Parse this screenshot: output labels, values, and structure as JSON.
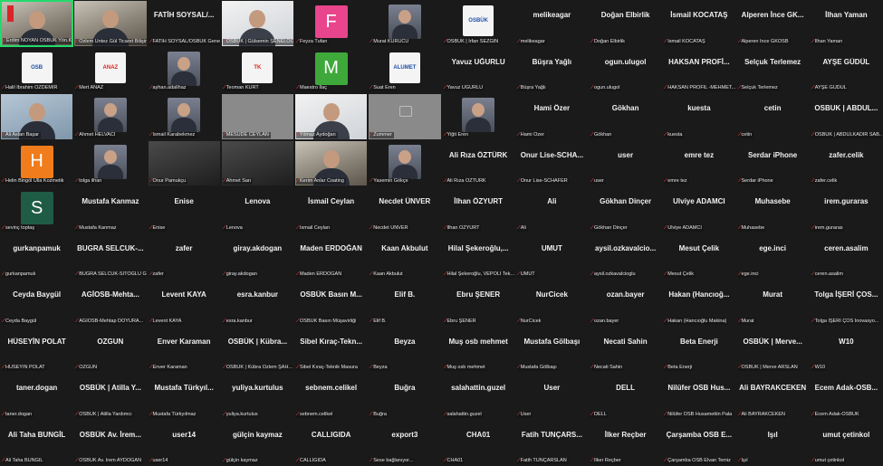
{
  "colors": {
    "background": "#1a1a1a",
    "active_speaker_border": "#23d96a",
    "muted_mic": "#ff3b3b"
  },
  "participants": [
    {
      "kind": "video",
      "variant": "video",
      "flag": true,
      "name": "Erdim NOYAN OSBÜK Yön.Kur.Üyesi",
      "active": true
    },
    {
      "kind": "video",
      "variant": "video",
      "name": "Özlem Üntez Gül Ticaret Bilişim"
    },
    {
      "kind": "name",
      "display": "FATİH SOYSAL/...",
      "name": "FATİH SOYSAL/OSBÜK Genel Sek."
    },
    {
      "kind": "video",
      "variant": "video light",
      "name": "OSBÜK | Gülsemin ŞENELOĞLU"
    },
    {
      "kind": "initial",
      "initial": "F",
      "color": "#e8458d",
      "name": "Feyza Tufan"
    },
    {
      "kind": "photo",
      "name": "Murat KURUCU"
    },
    {
      "kind": "logo",
      "logo": "OSBÜK",
      "name": "OSBÜK | İrfan SEZGİN"
    },
    {
      "kind": "name",
      "display": "melikeagar",
      "name": "melikeagar"
    },
    {
      "kind": "name",
      "display": "Doğan Elbirlik",
      "name": "Doğan Elbirlik"
    },
    {
      "kind": "name",
      "display": "İsmail KOCATAŞ",
      "name": "İsmail KOCATAŞ"
    },
    {
      "kind": "name",
      "display": "Alperen İnce GK...",
      "name": "Alperen İnce GKOSB"
    },
    {
      "kind": "name",
      "display": "İlhan Yaman",
      "name": "İlhan Yaman"
    },
    {
      "kind": "logo",
      "logo": "OSB",
      "name": "Halil İbrahim ÖZDEMİR"
    },
    {
      "kind": "logo",
      "logo": "ANAZ",
      "red": true,
      "name": "Mert ANAZ"
    },
    {
      "kind": "photo",
      "name": "ayhan.adalihaz"
    },
    {
      "kind": "logo",
      "logo": "TK",
      "red": true,
      "name": "Teoman KURT"
    },
    {
      "kind": "initial",
      "initial": "M",
      "color": "#3fa83a",
      "name": "Maestro İlaç"
    },
    {
      "kind": "logo",
      "logo": "ALUMET",
      "name": "Suat Eren"
    },
    {
      "kind": "name",
      "display": "Yavuz UĞURLU",
      "name": "Yavuz UĞURLU"
    },
    {
      "kind": "name",
      "display": "Büşra Yağlı",
      "name": "Büşra Yağlı"
    },
    {
      "kind": "name",
      "display": "ogun.ulugol",
      "name": "ogun.ulugol"
    },
    {
      "kind": "name",
      "display": "HAKSAN PROFİ...",
      "name": "HAKSAN PROFİL -MEHMET..."
    },
    {
      "kind": "name",
      "display": "Selçuk Terlemez",
      "name": "Selçuk Terlemez"
    },
    {
      "kind": "name",
      "display": "AYŞE GÜDÜL",
      "name": "AYŞE GÜDÜL"
    },
    {
      "kind": "video",
      "variant": "video blue",
      "name": "Ali Aslan Başar"
    },
    {
      "kind": "photo",
      "name": "Ahmet HELVACI"
    },
    {
      "kind": "photo",
      "name": "İsmail Karabekmez"
    },
    {
      "kind": "video",
      "variant": "video gray",
      "name": "MESUDE CEYLAN"
    },
    {
      "kind": "video",
      "variant": "video light",
      "name": "Yılmaz Aydoğan"
    },
    {
      "kind": "zoom",
      "variant": "video gray",
      "name": "Zummer"
    },
    {
      "kind": "photo",
      "name": "Yiğit Eren"
    },
    {
      "kind": "name",
      "display": "Hami Özer",
      "name": "Hami Özer"
    },
    {
      "kind": "name",
      "display": "Gökhan",
      "name": "Gökhan"
    },
    {
      "kind": "name",
      "display": "kuesta",
      "name": "kuesta"
    },
    {
      "kind": "name",
      "display": "cetin",
      "name": "cetin"
    },
    {
      "kind": "name",
      "display": "OSBUK | ABDUL...",
      "name": "OSBUK | ABDULKADİR SAB..."
    },
    {
      "kind": "initial",
      "initial": "H",
      "color": "#f07c1b",
      "name": "Helin Bingöl Ulla Kozmetik"
    },
    {
      "kind": "photo",
      "name": "tolga ilhan"
    },
    {
      "kind": "video",
      "variant": "video dark",
      "name": "Onur Pamukçu"
    },
    {
      "kind": "video",
      "variant": "video dark",
      "name": "Ahmet Sarı"
    },
    {
      "kind": "video",
      "variant": "video",
      "name": "Kerim Anlar Coating"
    },
    {
      "kind": "photo",
      "name": "Yasemin Gökçe"
    },
    {
      "kind": "name",
      "display": "Ali Rıza ÖZTÜRK",
      "name": "Ali Rıza ÖZTÜRK"
    },
    {
      "kind": "name",
      "display": "Onur Lise-SCHA...",
      "name": "Onur Lise-SCHAFER"
    },
    {
      "kind": "name",
      "display": "user",
      "name": "user"
    },
    {
      "kind": "name",
      "display": "emre tez",
      "name": "emre tez"
    },
    {
      "kind": "name",
      "display": "Serdar iPhone",
      "name": "Serdar iPhone"
    },
    {
      "kind": "name",
      "display": "zafer.celik",
      "name": "zafer.celik"
    },
    {
      "kind": "initial",
      "initial": "S",
      "color": "#1f5c45",
      "name": "sevinç toptaş"
    },
    {
      "kind": "name",
      "display": "Mustafa Kanmaz",
      "name": "Mustafa Kanmaz"
    },
    {
      "kind": "name",
      "display": "Enise",
      "name": "Enise"
    },
    {
      "kind": "name",
      "display": "Lenova",
      "name": "Lenova"
    },
    {
      "kind": "name",
      "display": "İsmail Ceylan",
      "name": "İsmail Ceylan"
    },
    {
      "kind": "name",
      "display": "Necdet ÜNVER",
      "name": "Necdet ÜNVER"
    },
    {
      "kind": "name",
      "display": "İlhan ÖZYURT",
      "name": "İlhan ÖZYURT"
    },
    {
      "kind": "name",
      "display": "Ali",
      "name": "Ali"
    },
    {
      "kind": "name",
      "display": "Gökhan Dinçer",
      "name": "Gökhan Dinçer"
    },
    {
      "kind": "name",
      "display": "Ulviye ADAMCI",
      "name": "Ulviye ADAMCI"
    },
    {
      "kind": "name",
      "display": "Muhasebe",
      "name": "Muhasebe"
    },
    {
      "kind": "name",
      "display": "irem.guraras",
      "name": "irem.guraras"
    },
    {
      "kind": "name",
      "display": "gurkanpamuk",
      "name": "gurkanpamuk"
    },
    {
      "kind": "name",
      "display": "BUGRA SELCUK-...",
      "name": "BUGRA SELCUK-SITOGLU G..."
    },
    {
      "kind": "name",
      "display": "zafer",
      "name": "zafer"
    },
    {
      "kind": "name",
      "display": "giray.akdogan",
      "name": "giray.akdogan"
    },
    {
      "kind": "name",
      "display": "Maden ERDOĞAN",
      "name": "Maden ERDOĞAN"
    },
    {
      "kind": "name",
      "display": "Kaan Akbulut",
      "name": "Kaan Akbulut"
    },
    {
      "kind": "name",
      "display": "Hilal Şekeroğlu,...",
      "name": "Hilal Şekeroğlu, VEPOLİ Tek..."
    },
    {
      "kind": "name",
      "display": "UMUT",
      "name": "UMUT"
    },
    {
      "kind": "name",
      "display": "aysil.ozkavalcio...",
      "name": "aysil.ozkavalcioglu"
    },
    {
      "kind": "name",
      "display": "Mesut Çelik",
      "name": "Mesut Çelik"
    },
    {
      "kind": "name",
      "display": "ege.inci",
      "name": "ege.inci"
    },
    {
      "kind": "name",
      "display": "ceren.asalim",
      "name": "ceren.asalim"
    },
    {
      "kind": "name",
      "display": "Ceyda Baygül",
      "name": "Ceyda Baygül"
    },
    {
      "kind": "name",
      "display": "AGİOSB-Mehta...",
      "name": "AGİOSB-Mehtap DOYURA..."
    },
    {
      "kind": "name",
      "display": "Levent KAYA",
      "name": "Levent KAYA"
    },
    {
      "kind": "name",
      "display": "esra.kanbur",
      "name": "esra.kanbur"
    },
    {
      "kind": "name",
      "display": "OSBÜK Basın M...",
      "name": "OSBÜK Basın Müşavirliği"
    },
    {
      "kind": "name",
      "display": "Elif B.",
      "name": "Elif B."
    },
    {
      "kind": "name",
      "display": "Ebru ŞENER",
      "name": "Ebru ŞENER"
    },
    {
      "kind": "name",
      "display": "NurCicek",
      "name": "NurCicek"
    },
    {
      "kind": "name",
      "display": "ozan.bayer",
      "name": "ozan.bayer"
    },
    {
      "kind": "name",
      "display": "Hakan (Hancıoğ...",
      "name": "Hakan (Hancıoğlu Makina)"
    },
    {
      "kind": "name",
      "display": "Murat",
      "name": "Murat"
    },
    {
      "kind": "name",
      "display": "Tolga İŞERİ ÇOS...",
      "name": "Tolga İŞERİ ÇOS İnovasyo..."
    },
    {
      "kind": "name",
      "display": "HÜSEYİN POLAT",
      "name": "HÜSEYİN POLAT"
    },
    {
      "kind": "name",
      "display": "OZGUN",
      "name": "OZGUN"
    },
    {
      "kind": "name",
      "display": "Enver Karaman",
      "name": "Enver Karaman"
    },
    {
      "kind": "name",
      "display": "OSBÜK | Kübra...",
      "name": "OSBÜK | Kübra Özlem ŞAH..."
    },
    {
      "kind": "name",
      "display": "Sibel Kıraç-Tekn...",
      "name": "Sibel Kıraç-Teknik Masura"
    },
    {
      "kind": "name",
      "display": "Beyza",
      "name": "Beyza"
    },
    {
      "kind": "name",
      "display": "Muş osb mehmet",
      "name": "Muş osb mehmet"
    },
    {
      "kind": "name",
      "display": "Mustafa Gölbaşı",
      "name": "Mustafa Gölbaşı"
    },
    {
      "kind": "name",
      "display": "Necati Sahin",
      "name": "Necati Sahin"
    },
    {
      "kind": "name",
      "display": "Beta Enerji",
      "name": "Beta Enerji"
    },
    {
      "kind": "name",
      "display": "OSBÜK | Merve...",
      "name": "OSBÜK | Merve ARSLAN"
    },
    {
      "kind": "name",
      "display": "W10",
      "name": "W10"
    },
    {
      "kind": "name",
      "display": "taner.dogan",
      "name": "taner.dogan"
    },
    {
      "kind": "name",
      "display": "OSBÜK | Atilla Y...",
      "name": "OSBÜK | Atilla Yardımcı"
    },
    {
      "kind": "name",
      "display": "Mustafa Türkyıl...",
      "name": "Mustafa Türkyılmaz"
    },
    {
      "kind": "name",
      "display": "yuliya.kurtulus",
      "name": "yuliya.kurtulus"
    },
    {
      "kind": "name",
      "display": "sebnem.celikel",
      "name": "sebnem.celikel"
    },
    {
      "kind": "name",
      "display": "Buğra",
      "name": "Buğra"
    },
    {
      "kind": "name",
      "display": "salahattin.guzel",
      "name": "salahattin.guzel"
    },
    {
      "kind": "name",
      "display": "User",
      "name": "User"
    },
    {
      "kind": "name",
      "display": "DELL",
      "name": "DELL"
    },
    {
      "kind": "name",
      "display": "Nilüfer OSB Hus...",
      "name": "Nilüfer OSB Husamettin Pala"
    },
    {
      "kind": "name",
      "display": "Ali BAYRAKCEKEN",
      "name": "Ali BAYRAKCEKEN"
    },
    {
      "kind": "name",
      "display": "Ecem Adak-OSB...",
      "name": "Ecem Adak-OSBÜK"
    },
    {
      "kind": "name",
      "display": "Ali Taha BUNGİL",
      "name": "Ali Taha BUNGİL"
    },
    {
      "kind": "name",
      "display": "OSBÜK Av. İrem...",
      "name": "OSBÜK Av. İrem AYDOĞAN"
    },
    {
      "kind": "name",
      "display": "user14",
      "name": "user14"
    },
    {
      "kind": "name",
      "display": "gülçin kaymaz",
      "name": "gülçin kaymaz"
    },
    {
      "kind": "name",
      "display": "CALLIGIDA",
      "name": "CALLIGIDA"
    },
    {
      "kind": "name",
      "display": "export3",
      "name": "Sese bağlanıyor..."
    },
    {
      "kind": "name",
      "display": "CHA01",
      "name": "CHA01"
    },
    {
      "kind": "name",
      "display": "Fatih TUNÇARS...",
      "name": "Fatih TUNÇARSLAN"
    },
    {
      "kind": "name",
      "display": "İlker Reçber",
      "name": "İlker Reçber"
    },
    {
      "kind": "name",
      "display": "Çarşamba OSB E...",
      "name": "Çarşamba OSB Elvan Temiz"
    },
    {
      "kind": "name",
      "display": "Işıl",
      "name": "Işıl"
    },
    {
      "kind": "name",
      "display": "umut çetinkol",
      "name": "umut çetinkol"
    }
  ]
}
